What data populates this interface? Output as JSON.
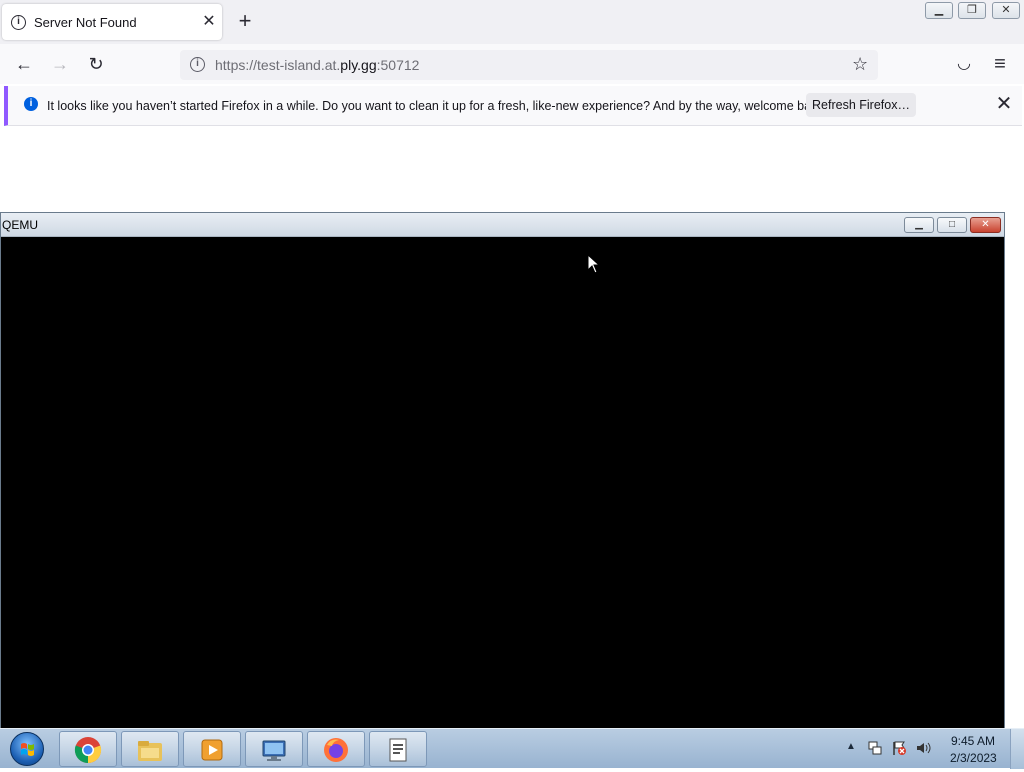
{
  "browser": {
    "tab": {
      "title": "Server Not Found",
      "close_glyph": "✕"
    },
    "new_tab_glyph": "+",
    "window_buttons": {
      "minimize": "▁",
      "restore": "❐",
      "close": "✕"
    },
    "nav": {
      "back": "←",
      "forward": "→",
      "reload": "↻"
    },
    "url": {
      "prefix": "https://test-island.at.",
      "domain": "ply.gg",
      "suffix": ":50712"
    },
    "bookmark_glyph": "☆",
    "pocket_glyph": "◡",
    "menu_glyph": "≡",
    "notification": {
      "icon": "i",
      "text": "It looks like you haven’t started Firefox in a while. Do you want to clean it up for a fresh, like-new experience? And by the way, welcome back!",
      "button_label": "Refresh Firefox…",
      "close_glyph": "✕"
    }
  },
  "qemu": {
    "title": "QEMU",
    "buttons": {
      "minimize": "▁",
      "maximize": "□",
      "close": "✕"
    }
  },
  "taskbar": {
    "items": [
      {
        "name": "chrome",
        "icon": "chrome-icon"
      },
      {
        "name": "explorer",
        "icon": "folder-icon"
      },
      {
        "name": "media",
        "icon": "media-player-icon"
      },
      {
        "name": "remote",
        "icon": "computer-icon"
      },
      {
        "name": "firefox",
        "icon": "firefox-icon"
      },
      {
        "name": "document",
        "icon": "document-icon"
      }
    ],
    "tray": {
      "arrow": "▲"
    },
    "clock": {
      "time": "9:45 AM",
      "date": "2/3/2023"
    }
  }
}
